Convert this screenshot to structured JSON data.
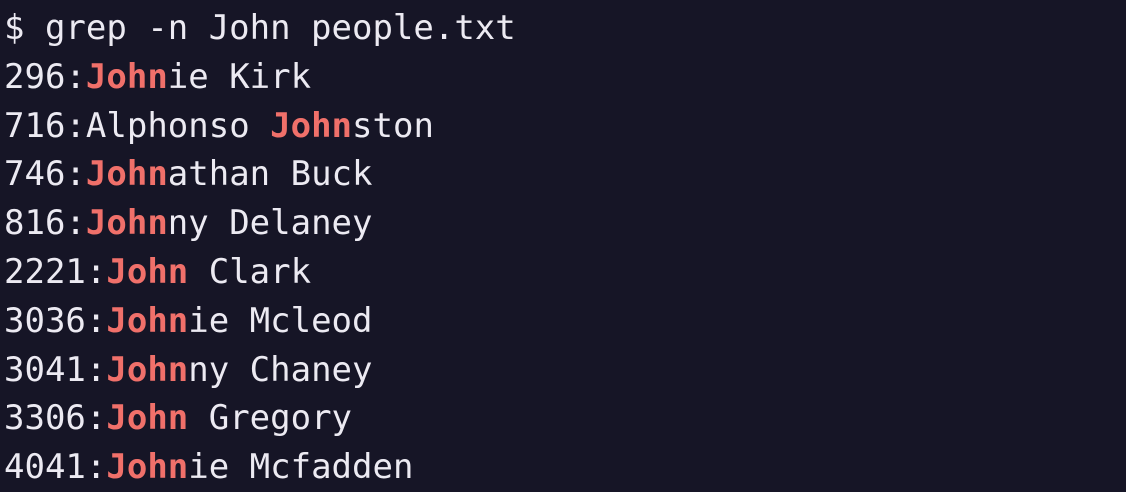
{
  "colors": {
    "background": "#161526",
    "text": "#eceaf2",
    "match": "#f0706a"
  },
  "terminal": {
    "prompt": "$ grep -n John people.txt",
    "results": [
      {
        "line_no": "296",
        "before": "",
        "match": "John",
        "after": "ie Kirk"
      },
      {
        "line_no": "716",
        "before": "Alphonso ",
        "match": "John",
        "after": "ston"
      },
      {
        "line_no": "746",
        "before": "",
        "match": "John",
        "after": "athan Buck"
      },
      {
        "line_no": "816",
        "before": "",
        "match": "John",
        "after": "ny Delaney"
      },
      {
        "line_no": "2221",
        "before": "",
        "match": "John",
        "after": " Clark"
      },
      {
        "line_no": "3036",
        "before": "",
        "match": "John",
        "after": "ie Mcleod"
      },
      {
        "line_no": "3041",
        "before": "",
        "match": "John",
        "after": "ny Chaney"
      },
      {
        "line_no": "3306",
        "before": "",
        "match": "John",
        "after": " Gregory"
      },
      {
        "line_no": "4041",
        "before": "",
        "match": "John",
        "after": "ie Mcfadden"
      }
    ]
  }
}
